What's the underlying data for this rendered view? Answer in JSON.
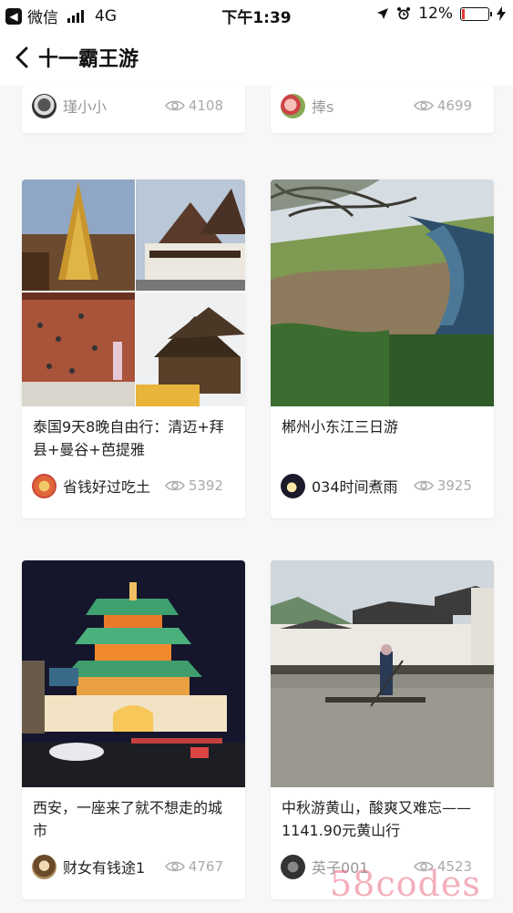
{
  "status_bar": {
    "carrier": "微信",
    "network": "4G",
    "time": "下午1:39",
    "battery": "12%",
    "battery_level": 0.12
  },
  "nav": {
    "title": "十一霸王游"
  },
  "cards": [
    {
      "author": "瑾小小",
      "views": "4108"
    },
    {
      "author": "捧s",
      "views": "4699"
    },
    {
      "title_line1": "泰国9天8晚自由行：清迈+拜",
      "title_line2": "县+曼谷+芭提雅",
      "author": "省钱好过吃土",
      "views": "5392"
    },
    {
      "title_line1": "郴州小东江三日游",
      "title_line2": "",
      "author": "034时间煮雨",
      "views": "3925"
    },
    {
      "title_line1": "西安，一座来了就不想走的城",
      "title_line2": "市",
      "author": "财女有钱途1",
      "views": "4767"
    },
    {
      "title_line1": "中秋游黄山，酸爽又难忘——",
      "title_line2": "1141.90元黄山行",
      "author": "英子001",
      "views": "4523"
    }
  ],
  "watermark": "58codes",
  "icons": {
    "back": "chevron-left-icon",
    "views": "eye-icon",
    "location": "location-arrow-icon",
    "alarm": "alarm-clock-icon",
    "charging": "lightning-icon"
  }
}
